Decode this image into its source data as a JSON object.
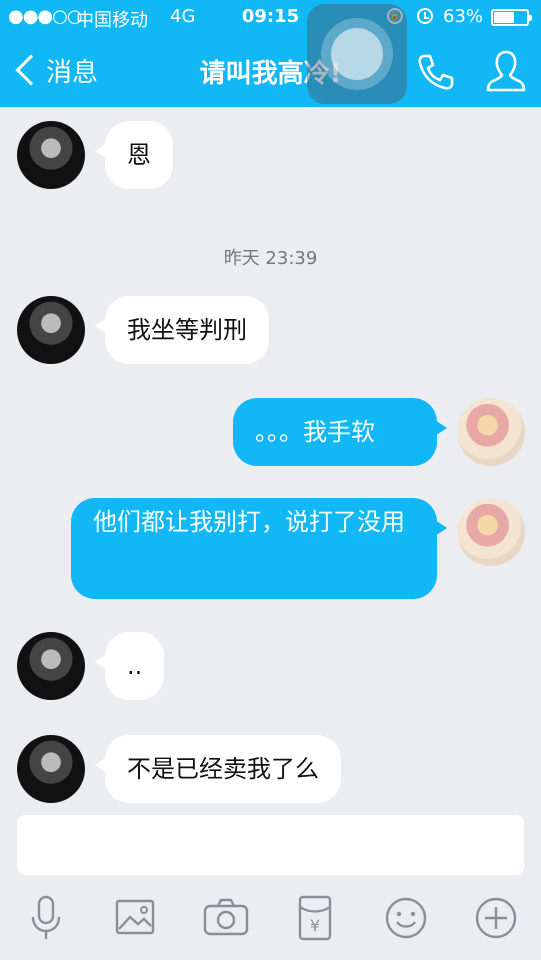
{
  "status_bar": {
    "signal": "●●●○○",
    "carrier": "中国移动",
    "network": "4G",
    "time": "09:15",
    "battery_percent": "63%",
    "battery_level": 0.63,
    "icons": [
      "orientation-lock-icon",
      "alarm-icon",
      "battery-icon"
    ]
  },
  "nav": {
    "back_label": "消息",
    "title": "请叫我高冷!"
  },
  "messages": [
    {
      "side": "in",
      "text": "恩"
    },
    {
      "type": "timestamp",
      "text": "昨天 23:39"
    },
    {
      "side": "in",
      "text": "我坐等判刑"
    },
    {
      "side": "out",
      "text": "。。。我手软"
    },
    {
      "side": "out",
      "text": "他们都让我别打，说打了没用"
    },
    {
      "side": "in",
      "text": ".."
    },
    {
      "side": "in",
      "text": "不是已经卖我了么"
    }
  ],
  "input": {
    "placeholder": ""
  },
  "toolbar": {
    "icons": [
      "microphone-icon",
      "image-icon",
      "camera-icon",
      "red-packet-icon",
      "emoji-icon",
      "plus-icon"
    ]
  },
  "colors": {
    "accent": "#12b7f5",
    "background": "#ebedf1",
    "incoming_bubble": "#ffffff",
    "outgoing_bubble": "#12b7f5"
  }
}
